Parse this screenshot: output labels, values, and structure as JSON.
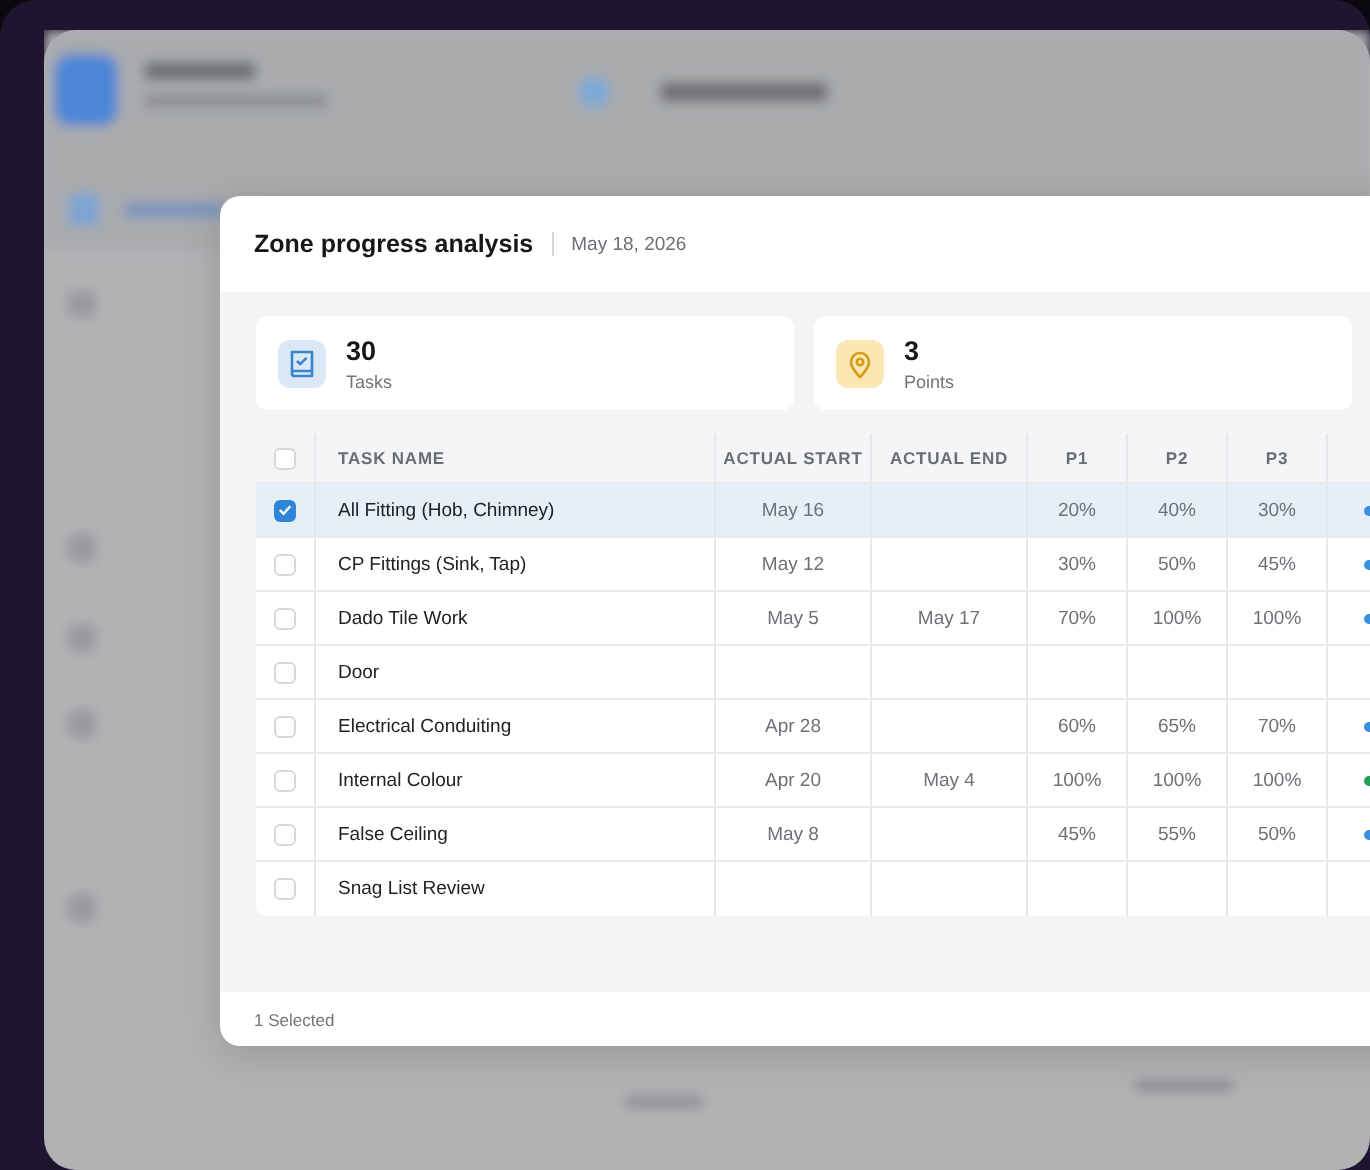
{
  "dialog": {
    "title": "Zone progress analysis",
    "date": "May 18, 2026"
  },
  "stats": [
    {
      "kind": "tasks",
      "value": "30",
      "label": "Tasks"
    },
    {
      "kind": "points",
      "value": "3",
      "label": "Points"
    }
  ],
  "table": {
    "select_all": {
      "checked": false
    },
    "columns": [
      "TASK NAME",
      "ACTUAL START",
      "ACTUAL END",
      "P1",
      "P2",
      "P3"
    ],
    "rows": [
      {
        "selected": true,
        "cells": [
          "All Fitting (Hob, Chimney)",
          "May 16",
          "",
          "20%",
          "40%",
          "30%"
        ],
        "color": "#3b8fe0"
      },
      {
        "selected": false,
        "cells": [
          "CP Fittings (Sink, Tap)",
          "May 12",
          "",
          "30%",
          "50%",
          "45%"
        ],
        "color": "#3b8fe0"
      },
      {
        "selected": false,
        "cells": [
          "Dado Tile Work",
          "May 5",
          "May 17",
          "70%",
          "100%",
          "100%"
        ],
        "color": "#3b8fe0"
      },
      {
        "selected": false,
        "cells": [
          "Door",
          "",
          "",
          "",
          "",
          ""
        ]
      },
      {
        "selected": false,
        "cells": [
          "Electrical Conduiting",
          "Apr 28",
          "",
          "60%",
          "65%",
          "70%"
        ],
        "color": "#3b8fe0"
      },
      {
        "selected": false,
        "cells": [
          "Internal Colour",
          "Apr 20",
          "May 4",
          "100%",
          "100%",
          "100%"
        ],
        "color": "#22a05a"
      },
      {
        "selected": false,
        "cells": [
          "False Ceiling",
          "May 8",
          "",
          "45%",
          "55%",
          "50%"
        ],
        "color": "#3b8fe0"
      },
      {
        "selected": false,
        "cells": [
          "Snag List Review",
          "",
          "",
          "",
          "",
          ""
        ]
      }
    ]
  },
  "footer": {
    "selection": "1 Selected"
  }
}
